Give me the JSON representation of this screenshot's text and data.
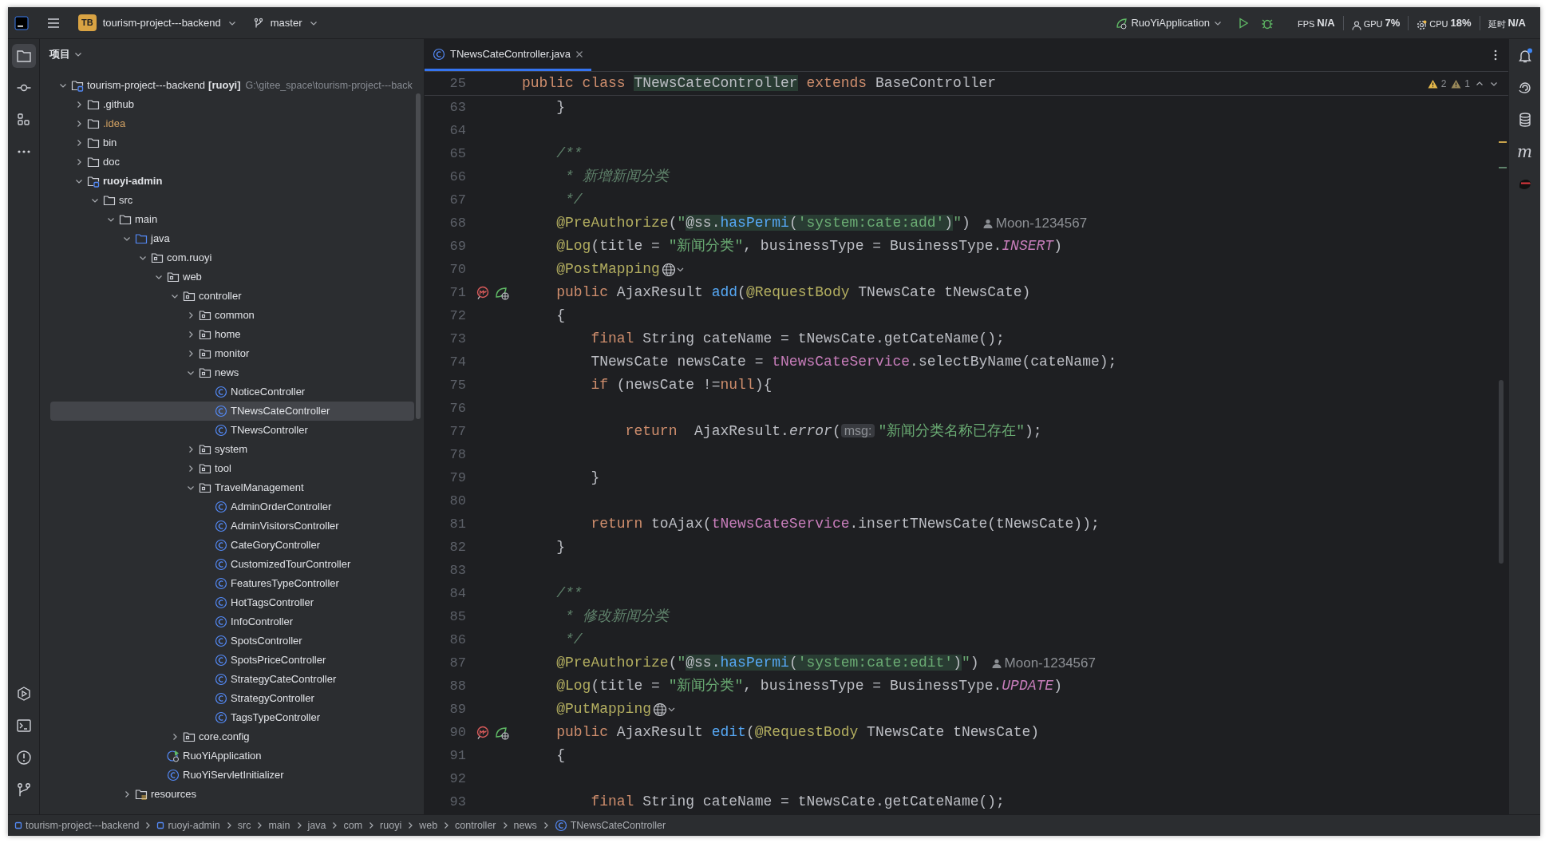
{
  "toolbar": {
    "project_badge": "TB",
    "project": "tourism-project---backend",
    "branch": "master",
    "run_config": "RuoYiApplication",
    "metrics": [
      {
        "kind": "fps",
        "label": "FPS",
        "value": "N/A"
      },
      {
        "kind": "gpu",
        "label": "GPU",
        "value": "7%"
      },
      {
        "kind": "cpu",
        "label": "CPU",
        "value": "18%"
      },
      {
        "kind": "latency",
        "label": "延时",
        "value": "N/A"
      }
    ]
  },
  "left_tools_top": [
    {
      "kind": "project",
      "selected": true
    },
    {
      "kind": "commit",
      "selected": false
    },
    {
      "kind": "structure",
      "selected": false
    },
    {
      "kind": "more",
      "selected": false
    }
  ],
  "left_tools_bottom": [
    {
      "kind": "run",
      "selected": false
    },
    {
      "kind": "terminal",
      "selected": false
    },
    {
      "kind": "problems",
      "selected": false
    },
    {
      "kind": "git",
      "selected": false
    }
  ],
  "project_panel": {
    "title": "项目",
    "tree": [
      {
        "label": "tourism-project---backend",
        "module_name": "[ruoyi]",
        "path": "G:\\gitee_space\\tourism-project---back",
        "kind": "module",
        "expanded": true,
        "selected": false,
        "children": [
          {
            "label": ".github",
            "kind": "folder",
            "expanded": false,
            "selected": false
          },
          {
            "label": ".idea",
            "kind": "ignored-folder",
            "expanded": false,
            "selected": false
          },
          {
            "label": "bin",
            "kind": "folder",
            "expanded": false,
            "selected": false
          },
          {
            "label": "doc",
            "kind": "folder",
            "expanded": false,
            "selected": false
          },
          {
            "label": "ruoyi-admin",
            "kind": "module",
            "expanded": true,
            "selected": false,
            "children": [
              {
                "label": "src",
                "kind": "folder",
                "expanded": true,
                "selected": false,
                "children": [
                  {
                    "label": "main",
                    "kind": "folder",
                    "expanded": true,
                    "selected": false,
                    "children": [
                      {
                        "label": "java",
                        "kind": "source-folder",
                        "expanded": true,
                        "selected": false,
                        "children": [
                          {
                            "label": "com.ruoyi",
                            "kind": "package",
                            "expanded": true,
                            "selected": false,
                            "children": [
                              {
                                "label": "web",
                                "kind": "package",
                                "expanded": true,
                                "selected": false,
                                "children": [
                                  {
                                    "label": "controller",
                                    "kind": "package",
                                    "expanded": true,
                                    "selected": false,
                                    "children": [
                                      {
                                        "label": "common",
                                        "kind": "package",
                                        "expanded": false,
                                        "selected": false
                                      },
                                      {
                                        "label": "home",
                                        "kind": "package",
                                        "expanded": false,
                                        "selected": false
                                      },
                                      {
                                        "label": "monitor",
                                        "kind": "package",
                                        "expanded": false,
                                        "selected": false
                                      },
                                      {
                                        "label": "news",
                                        "kind": "package",
                                        "expanded": true,
                                        "selected": false,
                                        "children": [
                                          {
                                            "label": "NoticeController",
                                            "kind": "class",
                                            "selected": false
                                          },
                                          {
                                            "label": "TNewsCateController",
                                            "kind": "class",
                                            "selected": true
                                          },
                                          {
                                            "label": "TNewsController",
                                            "kind": "class",
                                            "selected": false
                                          }
                                        ]
                                      },
                                      {
                                        "label": "system",
                                        "kind": "package",
                                        "expanded": false,
                                        "selected": false
                                      },
                                      {
                                        "label": "tool",
                                        "kind": "package",
                                        "expanded": false,
                                        "selected": false
                                      },
                                      {
                                        "label": "TravelManagement",
                                        "kind": "package",
                                        "expanded": true,
                                        "selected": false,
                                        "children": [
                                          {
                                            "label": "AdminOrderController",
                                            "kind": "class",
                                            "selected": false
                                          },
                                          {
                                            "label": "AdminVisitorsController",
                                            "kind": "class",
                                            "selected": false
                                          },
                                          {
                                            "label": "CateGoryController",
                                            "kind": "class",
                                            "selected": false
                                          },
                                          {
                                            "label": "CustomizedTourController",
                                            "kind": "class",
                                            "selected": false
                                          },
                                          {
                                            "label": "FeaturesTypeController",
                                            "kind": "class",
                                            "selected": false
                                          },
                                          {
                                            "label": "HotTagsController",
                                            "kind": "class",
                                            "selected": false
                                          },
                                          {
                                            "label": "InfoController",
                                            "kind": "class",
                                            "selected": false
                                          },
                                          {
                                            "label": "SpotsController",
                                            "kind": "class",
                                            "selected": false
                                          },
                                          {
                                            "label": "SpotsPriceController",
                                            "kind": "class",
                                            "selected": false
                                          },
                                          {
                                            "label": "StrategyCateController",
                                            "kind": "class",
                                            "selected": false
                                          },
                                          {
                                            "label": "StrategyController",
                                            "kind": "class",
                                            "selected": false
                                          },
                                          {
                                            "label": "TagsTypeController",
                                            "kind": "class",
                                            "selected": false
                                          }
                                        ]
                                      }
                                    ]
                                  },
                                  {
                                    "label": "core.config",
                                    "kind": "package",
                                    "expanded": false,
                                    "selected": false
                                  }
                                ]
                              },
                              {
                                "label": "RuoYiApplication",
                                "kind": "app-class",
                                "selected": false
                              },
                              {
                                "label": "RuoYiServletInitializer",
                                "kind": "class",
                                "selected": false
                              }
                            ]
                          }
                        ]
                      },
                      {
                        "label": "resources",
                        "kind": "resources",
                        "expanded": false,
                        "selected": false
                      }
                    ]
                  }
                ]
              }
            ]
          }
        ]
      }
    ]
  },
  "editor": {
    "tabs": [
      {
        "label": "TNewsCateController.java",
        "selected": true
      }
    ],
    "inspections": {
      "warnings": "2",
      "weak_warnings": "1"
    },
    "sticky_line": {
      "n": "25",
      "tokens": [
        {
          "kind": "kw",
          "text": "public class "
        },
        {
          "kind": "highlight",
          "text": "TNewsCateController"
        },
        {
          "kind": "kw",
          "text": " extends "
        },
        {
          "kind": "plain",
          "text": "BaseController"
        }
      ]
    },
    "lines": [
      {
        "n": "63",
        "tokens": [
          {
            "kind": "plain",
            "text": "    }"
          }
        ]
      },
      {
        "n": "64"
      },
      {
        "n": "65",
        "tokens": [
          {
            "kind": "doc",
            "text": "    /**"
          }
        ]
      },
      {
        "n": "66",
        "tokens": [
          {
            "kind": "doc",
            "text": "     * 新增新闻分类"
          }
        ]
      },
      {
        "n": "67",
        "tokens": [
          {
            "kind": "doc",
            "text": "     */"
          }
        ]
      },
      {
        "n": "68",
        "tokens": [
          {
            "kind": "ann",
            "text": "    @PreAuthorize"
          },
          {
            "kind": "plain",
            "text": "("
          },
          {
            "kind": "str",
            "text": "\""
          },
          {
            "kind": "highlight",
            "tokens": [
              {
                "kind": "plain",
                "text": "@ss."
              },
              {
                "kind": "fn",
                "text": "hasPermi"
              },
              {
                "kind": "plain",
                "text": "("
              },
              {
                "kind": "str",
                "text": "'system:cate:add'"
              },
              {
                "kind": "plain",
                "text": ")"
              }
            ]
          },
          {
            "kind": "str",
            "text": "\""
          },
          {
            "kind": "plain",
            "text": ")"
          }
        ],
        "author": "Moon-1234567"
      },
      {
        "n": "69",
        "tokens": [
          {
            "kind": "ann",
            "text": "    @Log"
          },
          {
            "kind": "plain",
            "text": "(title = "
          },
          {
            "kind": "str",
            "text": "\"新闻分类\""
          },
          {
            "kind": "plain",
            "text": ", businessType = BusinessType."
          },
          {
            "kind": "const",
            "text": "INSERT"
          },
          {
            "kind": "plain",
            "text": ")"
          }
        ]
      },
      {
        "n": "70",
        "tokens": [
          {
            "kind": "ann",
            "text": "    @PostMapping"
          }
        ],
        "web_inlay": true
      },
      {
        "n": "71",
        "tokens": [
          {
            "kind": "kw",
            "text": "    public "
          },
          {
            "kind": "plain",
            "text": "AjaxResult "
          },
          {
            "kind": "fn",
            "text": "add"
          },
          {
            "kind": "plain",
            "text": "("
          },
          {
            "kind": "ann",
            "text": "@RequestBody"
          },
          {
            "kind": "plain",
            "text": " TNewsCate tNewsCate)"
          }
        ],
        "gutter": true
      },
      {
        "n": "72",
        "tokens": [
          {
            "kind": "plain",
            "text": "    {"
          }
        ]
      },
      {
        "n": "73",
        "tokens": [
          {
            "kind": "kw",
            "text": "        final "
          },
          {
            "kind": "plain",
            "text": "String cateName = tNewsCate.getCateName();"
          }
        ]
      },
      {
        "n": "74",
        "tokens": [
          {
            "kind": "plain",
            "text": "        TNewsCate newsCate = "
          },
          {
            "kind": "fld",
            "text": "tNewsCateService"
          },
          {
            "kind": "plain",
            "text": ".selectByName(cateName);"
          }
        ]
      },
      {
        "n": "75",
        "tokens": [
          {
            "kind": "kw",
            "text": "        if "
          },
          {
            "kind": "plain",
            "text": "(newsCate !="
          },
          {
            "kind": "kw",
            "text": "null"
          },
          {
            "kind": "plain",
            "text": "){"
          }
        ]
      },
      {
        "n": "76"
      },
      {
        "n": "77",
        "tokens": [
          {
            "kind": "kw",
            "text": "            return  "
          },
          {
            "kind": "plain",
            "text": "AjaxResult."
          },
          {
            "kind": "static",
            "text": "error"
          },
          {
            "kind": "plain",
            "text": "("
          },
          {
            "kind": "hint",
            "text": "msg:"
          },
          {
            "kind": "str",
            "text": "\"新闻分类名称已存在\""
          },
          {
            "kind": "plain",
            "text": ");"
          }
        ]
      },
      {
        "n": "78"
      },
      {
        "n": "79",
        "tokens": [
          {
            "kind": "plain",
            "text": "        }"
          }
        ]
      },
      {
        "n": "80"
      },
      {
        "n": "81",
        "tokens": [
          {
            "kind": "kw",
            "text": "        return "
          },
          {
            "kind": "plain",
            "text": "toAjax("
          },
          {
            "kind": "fld",
            "text": "tNewsCateService"
          },
          {
            "kind": "plain",
            "text": ".insertTNewsCate(tNewsCate));"
          }
        ]
      },
      {
        "n": "82",
        "tokens": [
          {
            "kind": "plain",
            "text": "    }"
          }
        ]
      },
      {
        "n": "83"
      },
      {
        "n": "84",
        "tokens": [
          {
            "kind": "doc",
            "text": "    /**"
          }
        ]
      },
      {
        "n": "85",
        "tokens": [
          {
            "kind": "doc",
            "text": "     * 修改新闻分类"
          }
        ]
      },
      {
        "n": "86",
        "tokens": [
          {
            "kind": "doc",
            "text": "     */"
          }
        ]
      },
      {
        "n": "87",
        "tokens": [
          {
            "kind": "ann",
            "text": "    @PreAuthorize"
          },
          {
            "kind": "plain",
            "text": "("
          },
          {
            "kind": "str",
            "text": "\""
          },
          {
            "kind": "highlight",
            "tokens": [
              {
                "kind": "plain",
                "text": "@ss."
              },
              {
                "kind": "fn",
                "text": "hasPermi"
              },
              {
                "kind": "plain",
                "text": "("
              },
              {
                "kind": "str",
                "text": "'system:cate:edit'"
              },
              {
                "kind": "plain",
                "text": ")"
              }
            ]
          },
          {
            "kind": "str",
            "text": "\""
          },
          {
            "kind": "plain",
            "text": ")"
          }
        ],
        "author": "Moon-1234567"
      },
      {
        "n": "88",
        "tokens": [
          {
            "kind": "ann",
            "text": "    @Log"
          },
          {
            "kind": "plain",
            "text": "(title = "
          },
          {
            "kind": "str",
            "text": "\"新闻分类\""
          },
          {
            "kind": "plain",
            "text": ", businessType = BusinessType."
          },
          {
            "kind": "const",
            "text": "UPDATE"
          },
          {
            "kind": "plain",
            "text": ")"
          }
        ]
      },
      {
        "n": "89",
        "tokens": [
          {
            "kind": "ann",
            "text": "    @PutMapping"
          }
        ],
        "web_inlay": true
      },
      {
        "n": "90",
        "tokens": [
          {
            "kind": "kw",
            "text": "    public "
          },
          {
            "kind": "plain",
            "text": "AjaxResult "
          },
          {
            "kind": "fn",
            "text": "edit"
          },
          {
            "kind": "plain",
            "text": "("
          },
          {
            "kind": "ann",
            "text": "@RequestBody"
          },
          {
            "kind": "plain",
            "text": " TNewsCate tNewsCate)"
          }
        ],
        "gutter": true
      },
      {
        "n": "91",
        "tokens": [
          {
            "kind": "plain",
            "text": "    {"
          }
        ]
      },
      {
        "n": "92"
      },
      {
        "n": "93",
        "tokens": [
          {
            "kind": "kw",
            "text": "        final "
          },
          {
            "kind": "plain",
            "text": "String cateName = tNewsCate.getCateName();"
          }
        ]
      }
    ]
  },
  "breadcrumbs": [
    {
      "label": "tourism-project---backend",
      "kind": "module"
    },
    {
      "label": "ruoyi-admin",
      "kind": "module"
    },
    {
      "label": "src",
      "kind": "plain"
    },
    {
      "label": "main",
      "kind": "plain"
    },
    {
      "label": "java",
      "kind": "plain"
    },
    {
      "label": "com",
      "kind": "plain"
    },
    {
      "label": "ruoyi",
      "kind": "plain"
    },
    {
      "label": "web",
      "kind": "plain"
    },
    {
      "label": "controller",
      "kind": "plain"
    },
    {
      "label": "news",
      "kind": "plain"
    },
    {
      "label": "TNewsCateController",
      "kind": "class"
    }
  ],
  "right_tools": [
    {
      "kind": "notifications",
      "badge": true
    },
    {
      "kind": "ai"
    },
    {
      "kind": "database"
    },
    {
      "kind": "maven",
      "glyph": "m"
    },
    {
      "kind": "plugin"
    }
  ]
}
